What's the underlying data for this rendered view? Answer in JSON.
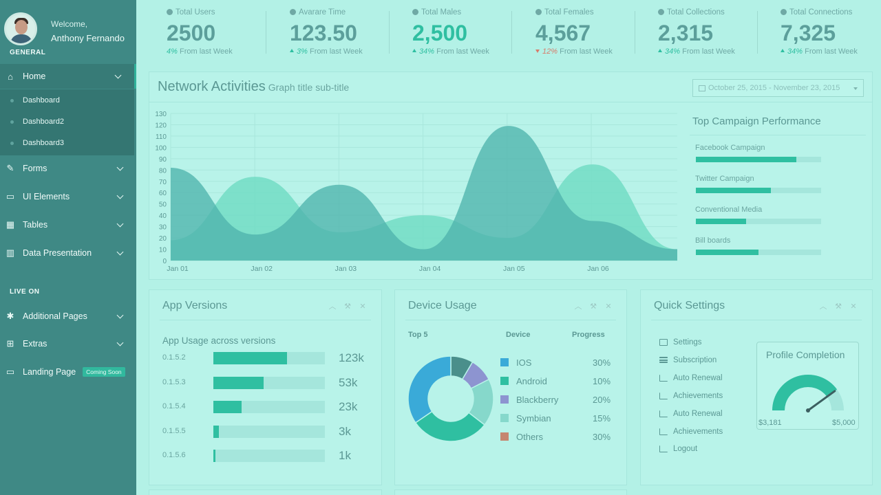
{
  "sidebar": {
    "welcome": "Welcome,",
    "username": "Anthony Fernando",
    "section_general": "GENERAL",
    "section_live": "LIVE ON",
    "items": {
      "home": "Home",
      "dashboard": "Dashboard",
      "dashboard2": "Dashboard2",
      "dashboard3": "Dashboard3",
      "forms": "Forms",
      "ui_elements": "UI Elements",
      "tables": "Tables",
      "data_presentation": "Data Presentation",
      "additional_pages": "Additional Pages",
      "extras": "Extras",
      "landing_page": "Landing Page",
      "coming_soon": "Coming Soon"
    }
  },
  "stats": [
    {
      "label": "Total Users",
      "value": "2500",
      "pct": "4%",
      "suffix": "From last Week",
      "trend": "none"
    },
    {
      "label": "Avarare Time",
      "value": "123.50",
      "pct": "3%",
      "suffix": "From last Week",
      "trend": "up"
    },
    {
      "label": "Total Males",
      "value": "2,500",
      "pct": "34%",
      "suffix": "From last Week",
      "trend": "up"
    },
    {
      "label": "Total Females",
      "value": "4,567",
      "pct": "12%",
      "suffix": "From last Week",
      "trend": "down"
    },
    {
      "label": "Total Collections",
      "value": "2,315",
      "pct": "34%",
      "suffix": "From last Week",
      "trend": "up"
    },
    {
      "label": "Total Connections",
      "value": "7,325",
      "pct": "34%",
      "suffix": "From last Week",
      "trend": "up"
    }
  ],
  "network": {
    "title": "Network Activities",
    "subtitle": "Graph title sub-title",
    "date_range": "October 25, 2015 - November 23, 2015"
  },
  "chart_data": [
    {
      "type": "area",
      "x": [
        "Jan 01",
        "Jan 02",
        "Jan 03",
        "Jan 04",
        "Jan 05",
        "Jan 06"
      ],
      "yticks": [
        0,
        10,
        20,
        30,
        40,
        50,
        60,
        70,
        80,
        90,
        100,
        110,
        120,
        130
      ],
      "ylim": [
        0,
        130
      ],
      "series": [
        {
          "values": [
            18,
            74,
            25,
            40,
            20,
            85,
            10
          ],
          "color": "#72dcc4"
        },
        {
          "values": [
            82,
            23,
            67,
            10,
            119,
            35,
            10
          ],
          "color": "#4fb3ad"
        }
      ]
    },
    {
      "type": "pie",
      "categories": [
        "IOS",
        "Android",
        "Blackberry",
        "Symbian",
        "Others"
      ],
      "values": [
        30,
        10,
        20,
        15,
        30
      ]
    }
  ],
  "campaign": {
    "title": "Top Campaign Performance",
    "items": [
      {
        "label": "Facebook Campaign",
        "value": 0.8
      },
      {
        "label": "Twitter Campaign",
        "value": 0.6
      },
      {
        "label": "Conventional Media",
        "value": 0.4
      },
      {
        "label": "Bill boards",
        "value": 0.5
      }
    ]
  },
  "app_versions": {
    "title": "App Versions",
    "subtitle": "App Usage across versions",
    "rows": [
      {
        "version": "0.1.5.2",
        "value": "123k",
        "fill": 0.66
      },
      {
        "version": "0.1.5.3",
        "value": "53k",
        "fill": 0.45
      },
      {
        "version": "0.1.5.4",
        "value": "23k",
        "fill": 0.25
      },
      {
        "version": "0.1.5.5",
        "value": "3k",
        "fill": 0.05
      },
      {
        "version": "0.1.5.6",
        "value": "1k",
        "fill": 0.02
      }
    ]
  },
  "device_usage": {
    "title": "Device Usage",
    "col_top": "Top 5",
    "col_device": "Device",
    "col_progress": "Progress",
    "rows": [
      {
        "device": "IOS",
        "pct": "30%",
        "color": "#3aaad8"
      },
      {
        "device": "Android",
        "pct": "10%",
        "color": "#2fbfa1"
      },
      {
        "device": "Blackberry",
        "pct": "20%",
        "color": "#8d94d0"
      },
      {
        "device": "Symbian",
        "pct": "15%",
        "color": "#86d8cb"
      },
      {
        "device": "Others",
        "pct": "30%",
        "color": "#c58670"
      }
    ],
    "donut_colors": {
      "ios": "#3aaad8",
      "dark": "#4a8f8b",
      "purple": "#8d94d0",
      "light": "#86d8cb",
      "green": "#2fbfa1"
    }
  },
  "quick_settings": {
    "title": "Quick Settings",
    "items": [
      "Settings",
      "Subscription",
      "Auto Renewal",
      "Achievements",
      "Auto Renewal",
      "Achievements",
      "Logout"
    ],
    "profile_title": "Profile Completion",
    "gauge_min": "$3,181",
    "gauge_max": "$5,000",
    "gauge_value": 0.8
  }
}
